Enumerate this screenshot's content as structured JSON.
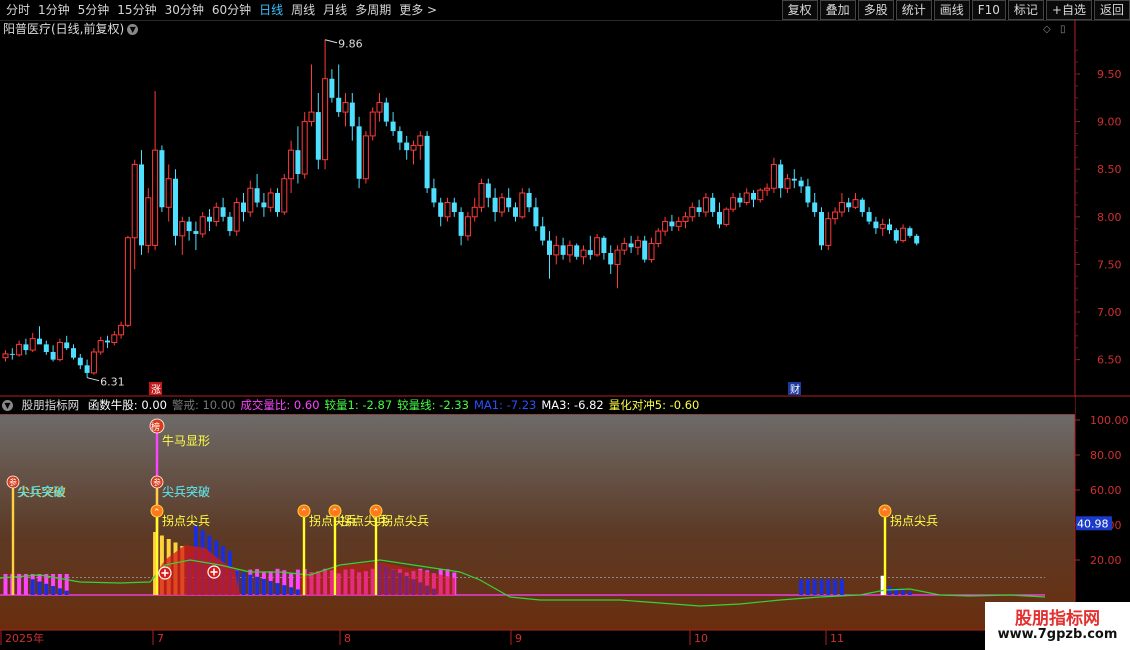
{
  "toolbar": {
    "periods": [
      "分时",
      "1分钟",
      "5分钟",
      "15分钟",
      "30分钟",
      "60分钟",
      "日线",
      "周线",
      "月线",
      "多周期",
      "更多 >"
    ],
    "active_period": "日线",
    "buttons": [
      "复权",
      "叠加",
      "多股",
      "统计",
      "画线",
      "F10",
      "标记",
      "+自选",
      "返回"
    ]
  },
  "main": {
    "title": "阳普医疗(日线,前复权)",
    "price_ticks": [
      "9.50",
      "9.00",
      "8.50",
      "8.00",
      "7.50",
      "7.00",
      "6.50"
    ],
    "high_label": "9.86",
    "low_label": "6.31",
    "marker_zhang": "涨",
    "marker_cai": "财"
  },
  "indicator": {
    "name": "股朋指标网",
    "items": [
      {
        "text": "函数牛股: 0.00",
        "color": "#ffffff"
      },
      {
        "text": "警戒: 10.00",
        "color": "#777777"
      },
      {
        "text": "成交量比: 0.60",
        "color": "#ff44ff"
      },
      {
        "text": "较量1: -2.87",
        "color": "#44ff44"
      },
      {
        "text": "较量线: -2.33",
        "color": "#44ff44"
      },
      {
        "text": "MA1: -7.23",
        "color": "#2b50ff"
      },
      {
        "text": "MA3: -6.82",
        "color": "#ffffff"
      },
      {
        "text": "量化对冲5: -0.60",
        "color": "#ffff44"
      }
    ],
    "ticks": [
      "100.00",
      "80.00",
      "60.00",
      "40.00",
      "20.00"
    ],
    "current_value": "40.98",
    "bang_badge": "榜",
    "can_badge": "参",
    "up_badge": "⌃",
    "signal_niuma": "牛马显形",
    "signal_jianbing": "尖兵突破",
    "signal_guaidian": "拐点尖兵"
  },
  "xaxis": {
    "labels": [
      "2025年",
      "7",
      "8",
      "9",
      "10",
      "11"
    ]
  },
  "watermark": {
    "title": "股朋指标网",
    "url": "www.7gpzb.com"
  }
}
